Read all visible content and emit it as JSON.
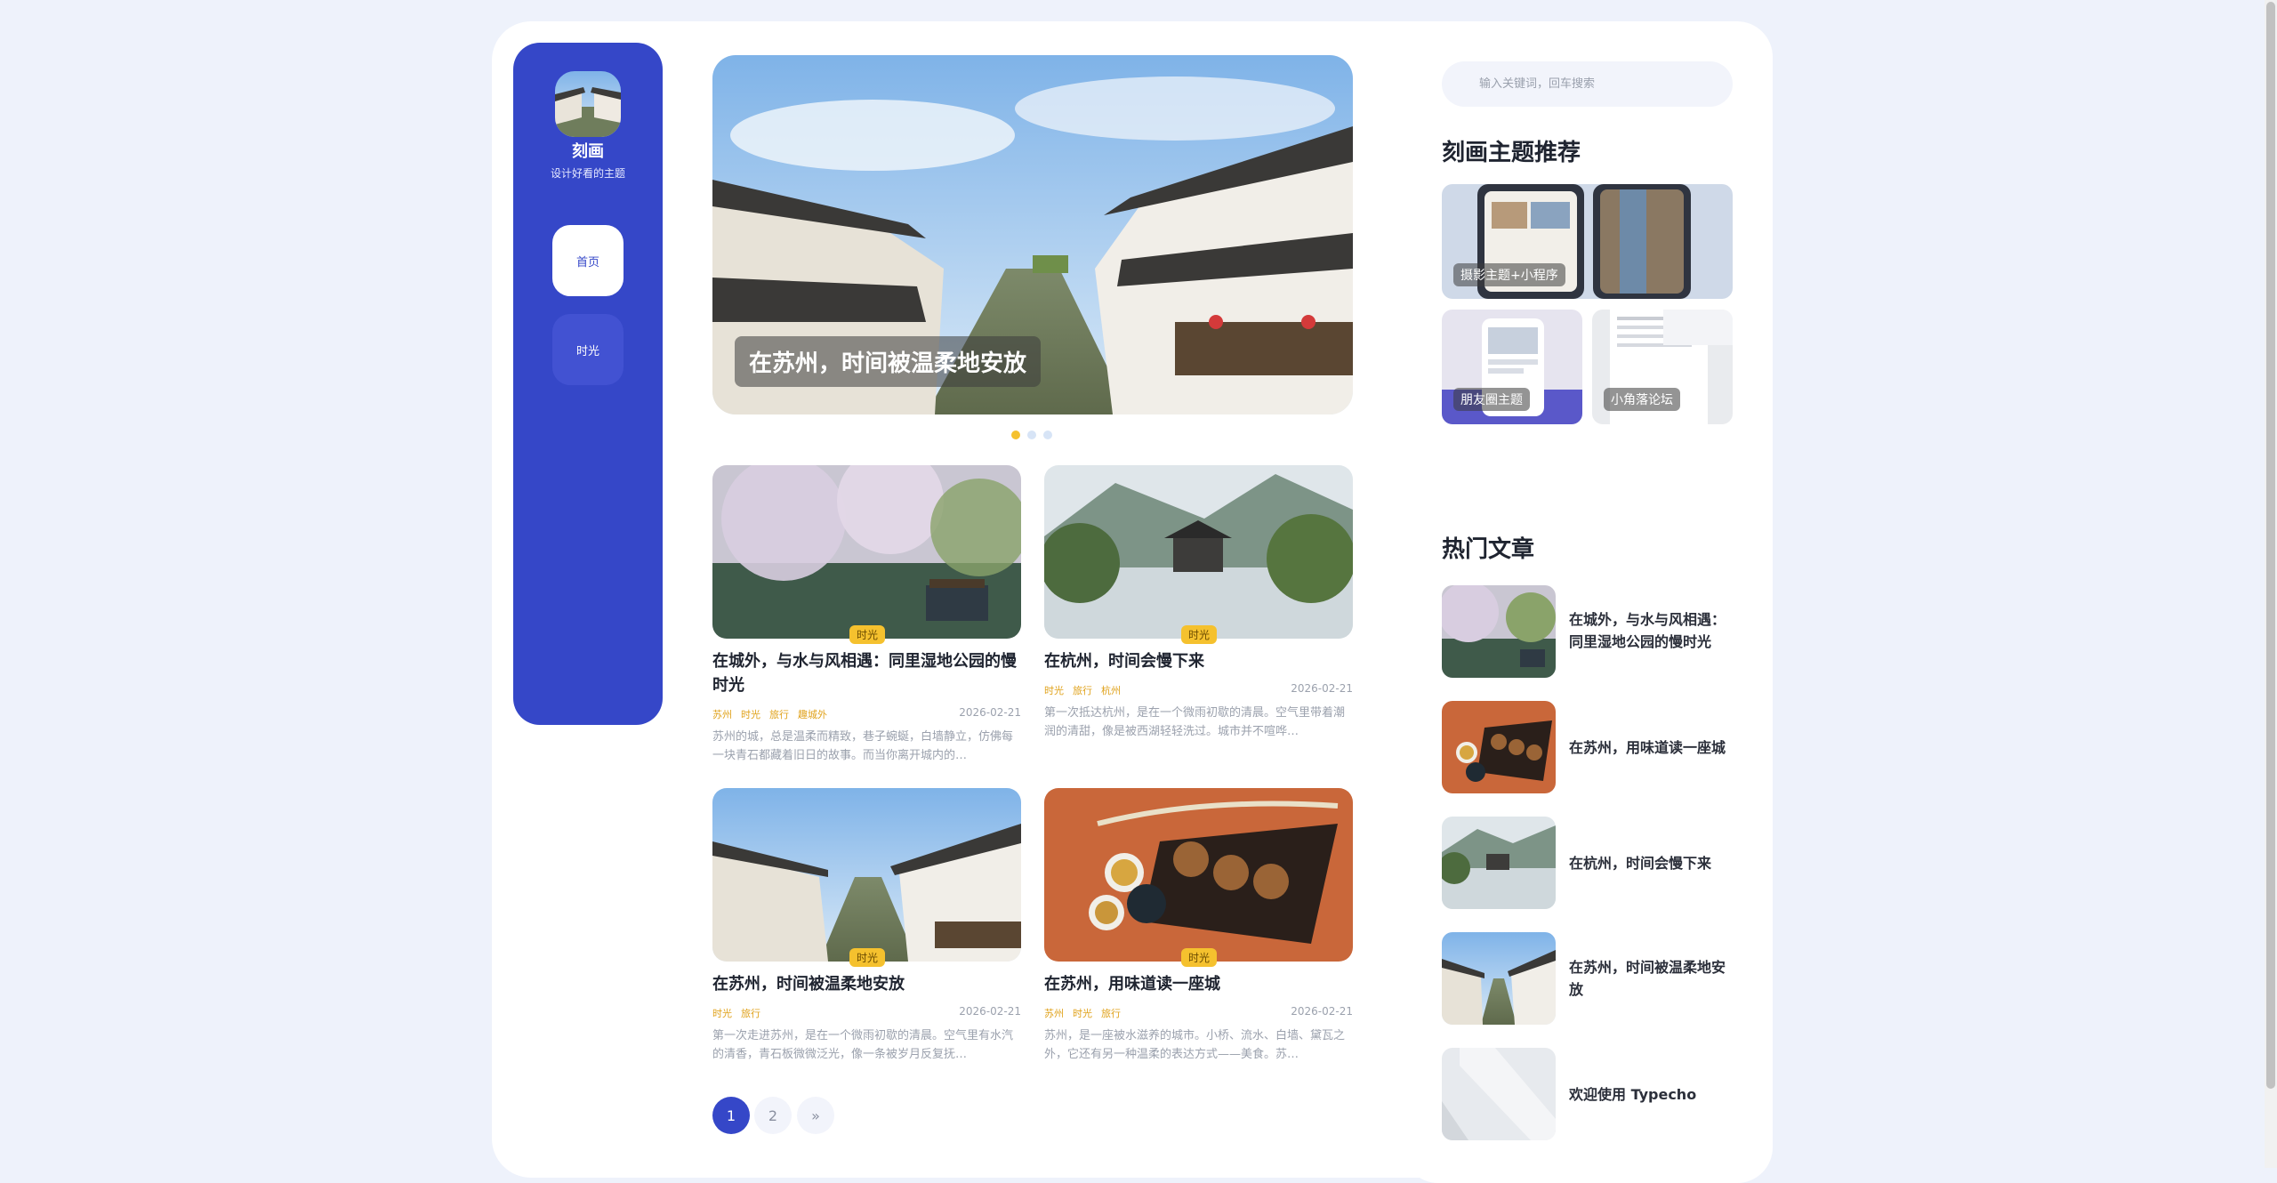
{
  "brand": {
    "name": "刻画",
    "subtitle": "设计好看的主题"
  },
  "nav": [
    {
      "label": "首页",
      "active": true
    },
    {
      "label": "时光",
      "active": false
    }
  ],
  "hero": {
    "caption": "在苏州，时间被温柔地安放",
    "slides": 3,
    "active_slide": 1
  },
  "posts": [
    {
      "title": "在城外，与水与风相遇：同里湿地公园的慢时光",
      "category": "时光",
      "tags": [
        "苏州",
        "时光",
        "旅行",
        "趣城外"
      ],
      "date": "2026-02-21",
      "excerpt": "苏州的城，总是温柔而精致，巷子蜿蜒，白墙静立，仿佛每一块青石都藏着旧日的故事。而当你离开城内的…"
    },
    {
      "title": "在杭州，时间会慢下来",
      "category": "时光",
      "tags": [
        "时光",
        "旅行",
        "杭州"
      ],
      "date": "2026-02-21",
      "excerpt": "第一次抵达杭州，是在一个微雨初歇的清晨。空气里带着潮润的清甜，像是被西湖轻轻洗过。城市并不喧哗…"
    },
    {
      "title": "在苏州，时间被温柔地安放",
      "category": "时光",
      "tags": [
        "时光",
        "旅行"
      ],
      "date": "2026-02-21",
      "excerpt": "第一次走进苏州，是在一个微雨初歇的清晨。空气里有水汽的清香，青石板微微泛光，像一条被岁月反复抚…"
    },
    {
      "title": "在苏州，用味道读一座城",
      "category": "时光",
      "tags": [
        "苏州",
        "时光",
        "旅行"
      ],
      "date": "2026-02-21",
      "excerpt": "苏州，是一座被水滋养的城市。小桥、流水、白墙、黛瓦之外，它还有另一种温柔的表达方式——美食。苏…"
    }
  ],
  "pagination": {
    "pages": [
      "1",
      "2"
    ],
    "next": "»",
    "current": "1"
  },
  "search": {
    "placeholder": "输入关键词，回车搜索"
  },
  "recommend": {
    "title": "刻画主题推荐",
    "items": [
      {
        "label": "摄影主题+小程序"
      },
      {
        "label": "朋友圈主题"
      },
      {
        "label": "小角落论坛"
      }
    ]
  },
  "hot": {
    "title": "热门文章",
    "items": [
      {
        "title": "在城外，与水与风相遇：同里湿地公园的慢时光"
      },
      {
        "title": "在苏州，用味道读一座城"
      },
      {
        "title": "在杭州，时间会慢下来"
      },
      {
        "title": "在苏州，时间被温柔地安放"
      },
      {
        "title": "欢迎使用 Typecho"
      }
    ]
  },
  "colors": {
    "accent": "#3547c8",
    "badge": "#f5c12e",
    "tag": "#e0a21b",
    "page_bg": "#eef2fb"
  }
}
